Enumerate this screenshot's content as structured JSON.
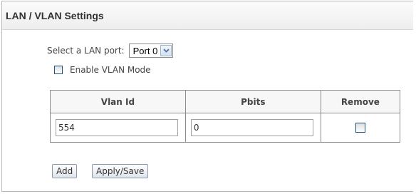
{
  "header": {
    "title": "LAN / VLAN Settings"
  },
  "lan_port": {
    "label": "Select a LAN port:",
    "selected": "Port 0"
  },
  "vlan_mode": {
    "label": "Enable VLAN Mode",
    "checked": false
  },
  "table": {
    "columns": [
      "Vlan Id",
      "Pbits",
      "Remove"
    ],
    "rows": [
      {
        "vlan_id": "554",
        "pbits": "0",
        "remove": false
      }
    ]
  },
  "buttons": {
    "add": "Add",
    "apply_save": "Apply/Save"
  },
  "colors": {
    "border": "#8c8c8c",
    "checkbox_border": "#1c5180",
    "arrow_blue": "#4a6fa5"
  }
}
